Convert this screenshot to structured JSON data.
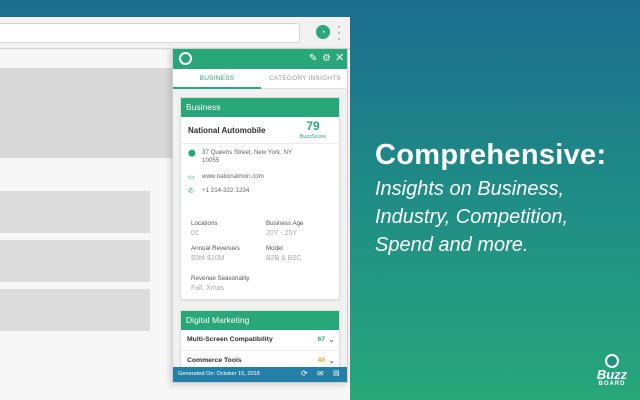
{
  "browser": {
    "ext_icon": "buzzboard-extension-icon",
    "menu_icon": "kebab-menu-icon"
  },
  "panel": {
    "tabs": [
      {
        "label": "BUSINESS",
        "active": true
      },
      {
        "label": "CATEGORY INSIGHTS",
        "active": false
      }
    ],
    "business": {
      "section_title": "Business",
      "name": "National Automobile",
      "buzzscore_value": "79",
      "buzzscore_label": "BuzzScore",
      "address": "37 Queens Street, New York, NY 10055",
      "website": "www.nationalmon.com",
      "phone": "+1 214-322-1234",
      "stats": {
        "locations_label": "Locations",
        "locations_value": "01",
        "age_label": "Business Age",
        "age_value": "20Y - 25Y",
        "revenue_label": "Annual Revenues",
        "revenue_value": "$5M-$10M",
        "model_label": "Model",
        "model_value": "B2B & B2C",
        "season_label": "Revenue Seasonality",
        "season_value": "Fall, Xmas"
      }
    },
    "digital": {
      "section_title": "Digital Marketing",
      "rows": [
        {
          "label": "Multi-Screen Compatibility",
          "value": "67"
        },
        {
          "label": "Commerce Tools",
          "value": "40"
        }
      ]
    },
    "footer": {
      "generated": "Generated On: October 15, 2018"
    }
  },
  "hero": {
    "headline": "Comprehensive:",
    "lines": [
      "Insights on Business,",
      "Industry, Competition,",
      "Spend and more."
    ]
  },
  "brand": {
    "name": "Buzz",
    "sub": "BOARD"
  },
  "colors": {
    "accent_green": "#27a77a",
    "footer_blue": "#2580a8",
    "amber": "#e3a521"
  }
}
